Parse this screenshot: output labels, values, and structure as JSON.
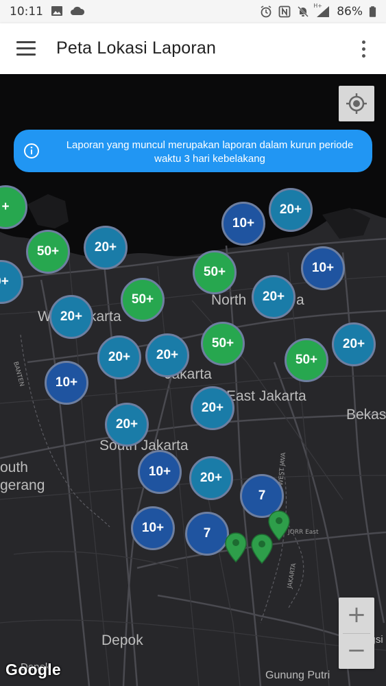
{
  "status_bar": {
    "time": "10:11",
    "battery": "86%",
    "network": "H+",
    "left_icons": [
      "image-icon",
      "cloud-icon"
    ],
    "right_icons": [
      "alarm-icon",
      "nfc-icon",
      "notifications-off-icon",
      "signal-icon",
      "battery-icon"
    ]
  },
  "app_bar": {
    "title": "Peta Lokasi Laporan",
    "menu_icon": "hamburger-menu-icon",
    "more_icon": "overflow-menu-icon"
  },
  "info_banner": {
    "text": "Laporan yang muncul merupakan laporan dalam kurun periode waktu 3 hari kebelakang",
    "icon": "info-icon"
  },
  "map": {
    "labels": {
      "north": "North",
      "north_suffix": "a",
      "west_prefix": "W",
      "west_suffix": "karta",
      "central": "Jakarta",
      "east": "East Jakarta",
      "bekasi": "Bekas",
      "south": "South Jakarta",
      "south_tangerang_1": "outh",
      "south_tangerang_2": "gerang",
      "depok": "Depok",
      "gunung_putri": "Gunung Putri",
      "cileungsi": "Cileungsi",
      "depok_bottom": "Depok"
    },
    "road_labels": {
      "west_java": "WEST JAVA",
      "jorr_east": "JORR East",
      "jakarta": "JAKARTA",
      "banten": "BANTEN"
    },
    "clusters": [
      {
        "label": "+"
      },
      {
        "label": "10+"
      },
      {
        "label": "20+"
      },
      {
        "label": "50+"
      },
      {
        "label": "20+"
      },
      {
        "label": "0+"
      },
      {
        "label": "50+"
      },
      {
        "label": "10+"
      },
      {
        "label": "50+"
      },
      {
        "label": "20+"
      },
      {
        "label": "20+"
      },
      {
        "label": "20+"
      },
      {
        "label": "20+"
      },
      {
        "label": "50+"
      },
      {
        "label": "50+"
      },
      {
        "label": "20+"
      },
      {
        "label": "10+"
      },
      {
        "label": "20+"
      },
      {
        "label": "20+"
      },
      {
        "label": "10+"
      },
      {
        "label": "20+"
      },
      {
        "label": "7"
      },
      {
        "label": "10+"
      },
      {
        "label": "7"
      }
    ],
    "marker_icon": "map-pin-icon",
    "pin_color": "#2e9e4a",
    "locate_icon": "my-location-icon",
    "zoom_in": "+",
    "zoom_out": "−",
    "attribution": "Google"
  },
  "colors": {
    "cluster_10": "#1f54a0",
    "cluster_20": "#1a7ca8",
    "cluster_50": "#27a74f",
    "banner": "#2196f3",
    "map_bg": "#212124"
  }
}
